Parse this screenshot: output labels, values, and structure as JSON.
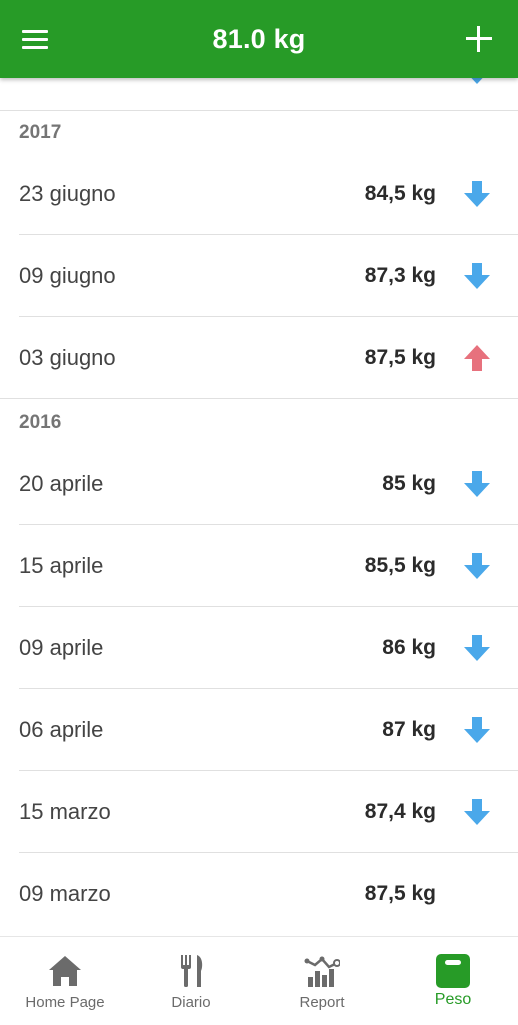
{
  "header": {
    "title": "81.0 kg",
    "menu_icon": "hamburger-menu-icon",
    "add_icon": "plus-icon",
    "color": "#279b27"
  },
  "colors": {
    "arrow_down": "#4aa8ea",
    "arrow_up": "#e7717d",
    "active_nav": "#279b27"
  },
  "groups": [
    {
      "year": "2017",
      "entries": [
        {
          "date": "23 giugno",
          "weight": "84,5 kg",
          "trend": "down"
        },
        {
          "date": "09 giugno",
          "weight": "87,3 kg",
          "trend": "down"
        },
        {
          "date": "03 giugno",
          "weight": "87,5 kg",
          "trend": "up"
        }
      ]
    },
    {
      "year": "2016",
      "entries": [
        {
          "date": "20 aprile",
          "weight": "85 kg",
          "trend": "down"
        },
        {
          "date": "15 aprile",
          "weight": "85,5 kg",
          "trend": "down"
        },
        {
          "date": "09 aprile",
          "weight": "86 kg",
          "trend": "down"
        },
        {
          "date": "06 aprile",
          "weight": "87 kg",
          "trend": "down"
        },
        {
          "date": "15 marzo",
          "weight": "87,4 kg",
          "trend": "down"
        },
        {
          "date": "09 marzo",
          "weight": "87,5 kg",
          "trend": "none"
        }
      ]
    }
  ],
  "bottom_nav": [
    {
      "label": "Home Page",
      "icon": "home-icon",
      "active": false
    },
    {
      "label": "Diario",
      "icon": "fork-knife-icon",
      "active": false
    },
    {
      "label": "Report",
      "icon": "report-chart-icon",
      "active": false
    },
    {
      "label": "Peso",
      "icon": "scale-icon",
      "active": true
    }
  ]
}
